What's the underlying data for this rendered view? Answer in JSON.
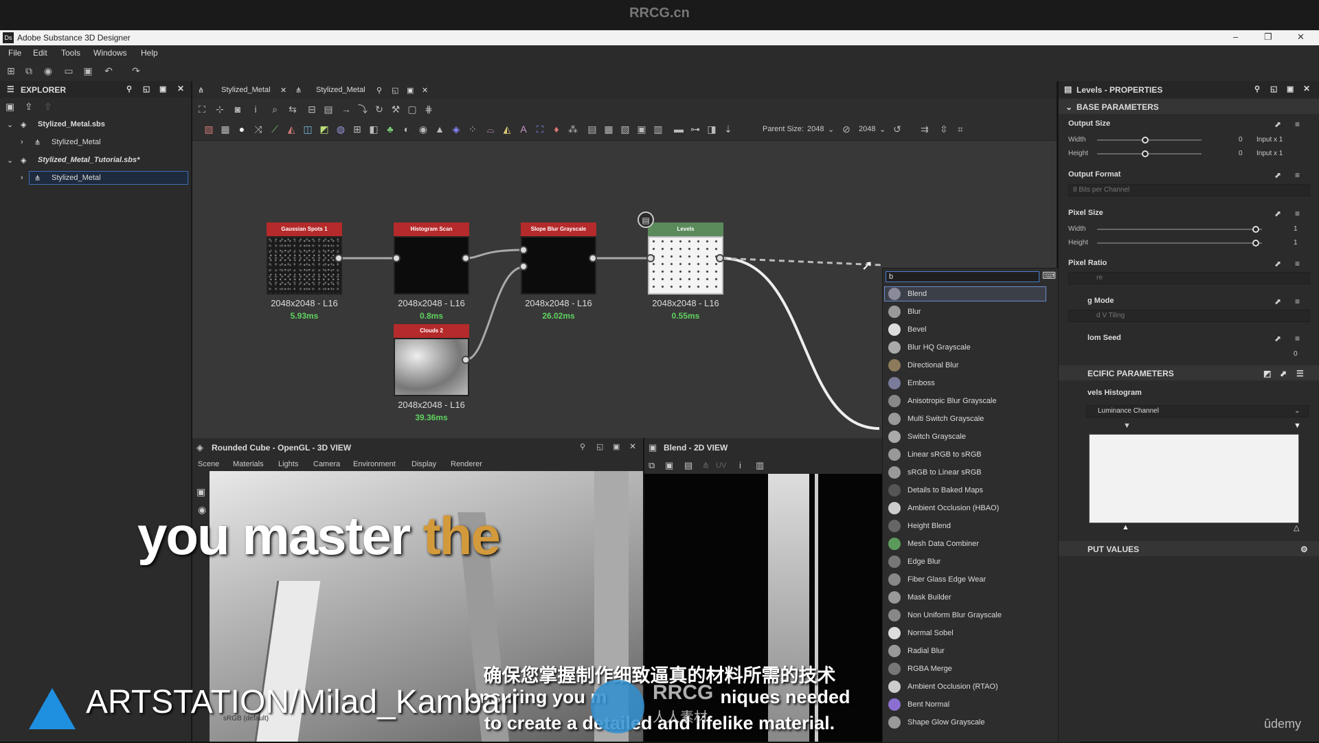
{
  "watermark_top": "RRCG.cn",
  "window": {
    "title": "Adobe Substance 3D Designer",
    "icon": "Ds"
  },
  "menu": [
    "File",
    "Edit",
    "Tools",
    "Windows",
    "Help"
  ],
  "explorer": {
    "title": "EXPLORER",
    "items": [
      {
        "label": "Stylized_Metal.sbs"
      },
      {
        "label": "Stylized_Metal"
      },
      {
        "label": "Stylized_Metal_Tutorial.sbs*"
      },
      {
        "label": "Stylized_Metal"
      }
    ]
  },
  "graph": {
    "tabs": [
      {
        "label": "Stylized_Metal"
      },
      {
        "label": "Stylized_Metal"
      }
    ],
    "parent_size_label": "Parent Size:",
    "parent_size_value": "2048",
    "size_value": "2048",
    "nodes": [
      {
        "name": "Gaussian Spots 1",
        "res": "2048x2048 - L16",
        "time": "5.93ms"
      },
      {
        "name": "Histogram Scan",
        "res": "2048x2048 - L16",
        "time": "0.8ms"
      },
      {
        "name": "Slope Blur Grayscale",
        "res": "2048x2048 - L16",
        "time": "26.02ms"
      },
      {
        "name": "Levels",
        "res": "2048x2048 - L16",
        "time": "0.55ms"
      },
      {
        "name": "Clouds 2",
        "res": "2048x2048 - L16",
        "time": "39.36ms"
      }
    ]
  },
  "search": {
    "value": "b",
    "results": [
      "Blend",
      "Blur",
      "Bevel",
      "Blur HQ Grayscale",
      "Directional Blur",
      "Emboss",
      "Anisotropic Blur Grayscale",
      "Multi Switch Grayscale",
      "Switch Grayscale",
      "Linear sRGB to sRGB",
      "sRGB to Linear sRGB",
      "Details to Baked Maps",
      "Ambient Occlusion (HBAO)",
      "Height Blend",
      "Mesh Data Combiner",
      "Edge Blur",
      "Fiber Glass Edge Wear",
      "Mask Builder",
      "Non Uniform Blur Grayscale",
      "Normal Sobel",
      "Radial Blur",
      "RGBA Merge",
      "Ambient Occlusion (RTAO)",
      "Bent Normal",
      "Shape Glow Grayscale"
    ]
  },
  "properties": {
    "title": "Levels - PROPERTIES",
    "base_parameters": "BASE PARAMETERS",
    "output_size": "Output Size",
    "width_label": "Width",
    "height_label": "Height",
    "output_size_width_value": "0",
    "output_size_height_value": "0",
    "input_x1": "Input x 1",
    "output_format": "Output Format",
    "output_format_value": "8 Bits per Channel",
    "pixel_size": "Pixel Size",
    "pixel_size_width_value": "1",
    "pixel_size_height_value": "1",
    "pixel_ratio": "Pixel Ratio",
    "pixel_ratio_value": "re",
    "tiling_mode": "g Mode",
    "tiling_value": "d V Tiling",
    "random_seed": "lom Seed",
    "random_seed_value": "0",
    "specific_parameters": "ECIFIC PARAMETERS",
    "levels_histogram": "vels Histogram",
    "channel_value": "Luminance Channel",
    "input_values": "PUT VALUES"
  },
  "view3d": {
    "title": "Rounded Cube - OpenGL - 3D VIEW",
    "menu": [
      "Scene",
      "Materials",
      "Lights",
      "Camera",
      "Environment",
      "Display",
      "Renderer"
    ],
    "status": "sRGB (default)"
  },
  "view2d": {
    "title": "Blend - 2D VIEW",
    "uv": "UV"
  },
  "overlay": {
    "subtitle_main": "you master",
    "subtitle_highlight": "the",
    "subtitle_cn": "确保您掌握制作细致逼真的材料所需的技术",
    "subtitle_line1_a": "ensuring you m",
    "subtitle_line1_b": "niques needed",
    "subtitle_line2": "to create a detailed and lifelike material.",
    "artstation": "ARTSTATION/Milad_Kambari",
    "udemy": "ûdemy",
    "rrcg_logo": "RRCG",
    "rrcg_cn": "人人素材"
  },
  "colors": {
    "node_header_red": "#b52a2a",
    "node_header_green": "#5b8a5b",
    "time_green": "#5fd35f",
    "accent_blue": "#4a7fd0",
    "subtitle_orange": "#d39a3c"
  }
}
